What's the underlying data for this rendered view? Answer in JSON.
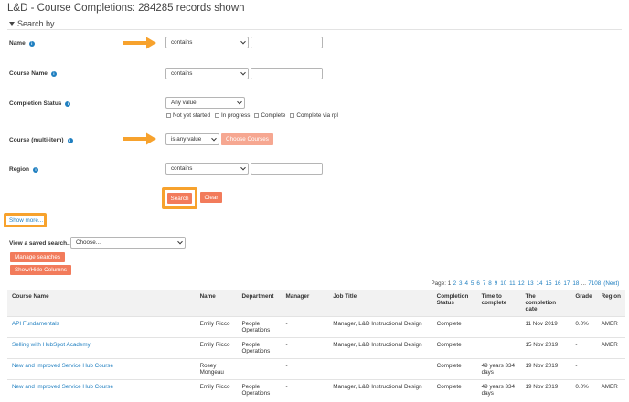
{
  "page": {
    "title": "L&D - Course Completions: 284285 records shown"
  },
  "search": {
    "heading": "Search by",
    "fields": {
      "name": {
        "label": "Name",
        "operator": "contains",
        "value": ""
      },
      "course_name": {
        "label": "Course Name",
        "operator": "contains",
        "value": ""
      },
      "completion_status": {
        "label": "Completion Status",
        "operator": "Any value",
        "options": [
          "Not yet started",
          "In progress",
          "Complete",
          "Complete via rpl"
        ]
      },
      "course_multi": {
        "label": "Course (multi-item)",
        "operator": "is any value",
        "button": "Choose Courses"
      },
      "region": {
        "label": "Region",
        "operator": "contains",
        "value": ""
      }
    },
    "search_button": "Search",
    "clear_button": "Clear",
    "show_more": "Show more..."
  },
  "saved": {
    "label": "View a saved search...",
    "selected": "Choose...",
    "manage_button": "Manage searches",
    "columns_button": "Show/Hide Columns"
  },
  "pager": {
    "prefix": "Page:",
    "current": "1",
    "pages": [
      "2",
      "3",
      "4",
      "5",
      "6",
      "7",
      "8",
      "9",
      "10",
      "11",
      "12",
      "13",
      "14",
      "15",
      "16",
      "17",
      "18"
    ],
    "ellipsis": "...",
    "last": "7108",
    "next": "(Next)"
  },
  "table": {
    "headers": [
      "Course Name",
      "Name",
      "Department",
      "Manager",
      "Job Title",
      "Completion Status",
      "Time to complete",
      "The completion date",
      "Grade",
      "Region"
    ],
    "rows": [
      [
        "API Fundamentals",
        "Emily Ricco",
        "People Operations",
        "-",
        "Manager, L&D Instructional Design",
        "Complete",
        "",
        "11 Nov 2019",
        "0.0%",
        "AMER"
      ],
      [
        "Selling with HubSpot Academy",
        "Emily Ricco",
        "People Operations",
        "-",
        "Manager, L&D Instructional Design",
        "Complete",
        "",
        "15 Nov 2019",
        "-",
        "AMER"
      ],
      [
        "New and Improved Service Hub Course",
        "Rosey Mongeau",
        "",
        "-",
        "",
        "Complete",
        "49 years 334 days",
        "19 Nov 2019",
        "-",
        ""
      ],
      [
        "New and Improved Service Hub Course",
        "Emily Ricco",
        "People Operations",
        "-",
        "Manager, L&D Instructional Design",
        "Complete",
        "49 years 334 days",
        "19 Nov 2019",
        "0.0%",
        "AMER"
      ]
    ]
  },
  "colors": {
    "accent": "#f27b5b",
    "highlight": "#f7a22d",
    "link": "#1f7fc0"
  }
}
